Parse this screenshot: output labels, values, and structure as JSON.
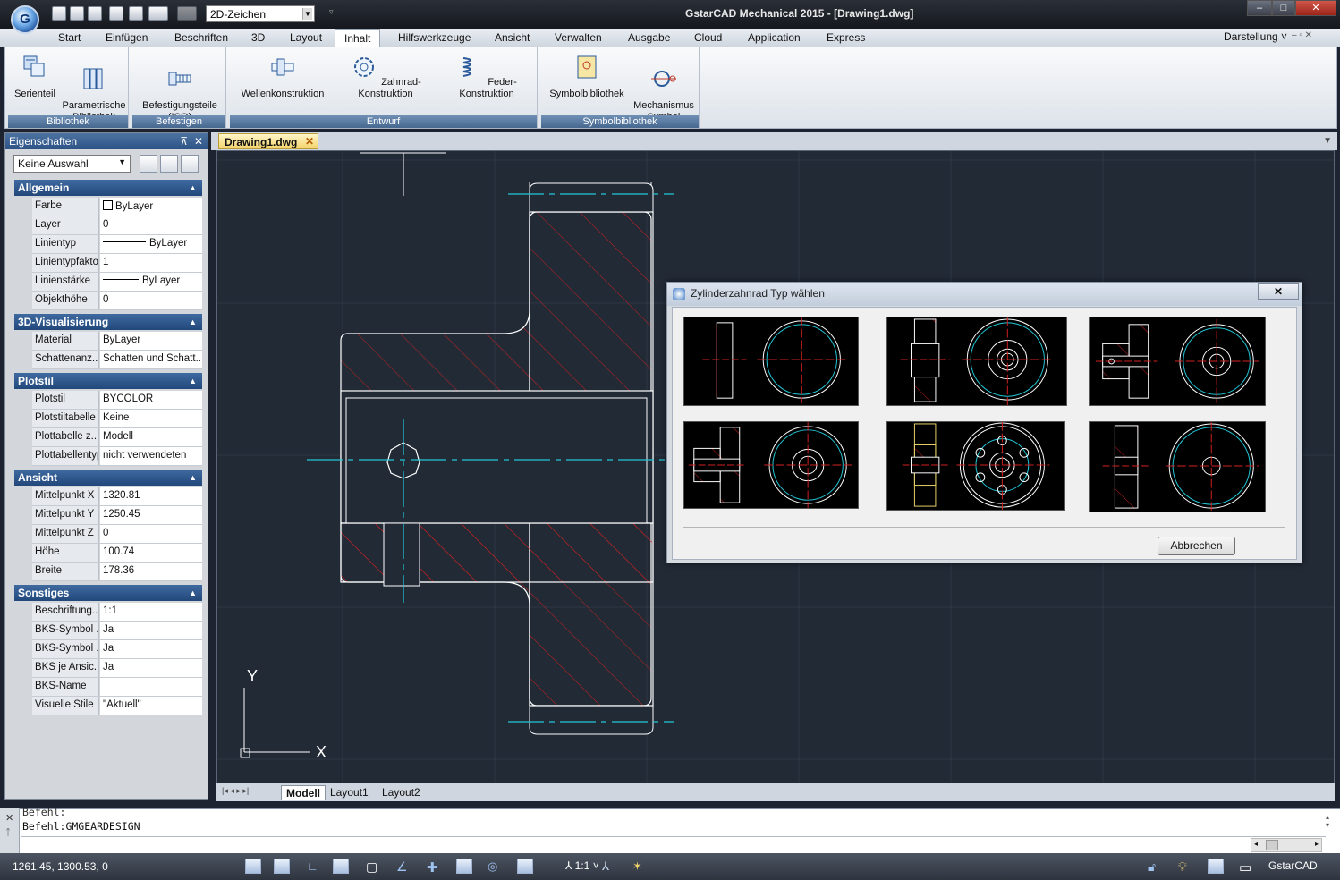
{
  "window": {
    "title": "GstarCAD Mechanical 2015 - [Drawing1.dwg]",
    "workspace": "2D-Zeichen",
    "controls": [
      "‒",
      "□",
      "✕"
    ]
  },
  "menu": {
    "tabs": [
      "Start",
      "Einfügen",
      "Beschriften",
      "3D",
      "Layout",
      "Inhalt",
      "Hilfswerkzeuge",
      "Ansicht",
      "Verwalten",
      "Ausgabe",
      "Cloud",
      "Application",
      "Express"
    ],
    "active": "Inhalt",
    "right": "Darstellung"
  },
  "ribbon": {
    "groups": [
      {
        "label": "Bibliothek",
        "buttons": [
          "Serienteil",
          "Parametrische\nBibliothek"
        ]
      },
      {
        "label": "Befestigen",
        "buttons": [
          "Befestigungsteile\n(ISO)"
        ]
      },
      {
        "label": "Entwurf",
        "buttons": [
          "Wellenkonstruktion",
          "Zahnrad-Konstruktion",
          "Feder-Konstruktion"
        ]
      },
      {
        "label": "Symbolbibliothek",
        "buttons": [
          "Symbolbibliothek",
          "Mechanismus\nSymbol"
        ]
      }
    ]
  },
  "properties": {
    "title": "Eigenschaften",
    "selection": "Keine Auswahl",
    "sections": [
      {
        "title": "Allgemein",
        "rows": [
          [
            "Farbe",
            "ByLayer"
          ],
          [
            "Layer",
            "0"
          ],
          [
            "Linientyp",
            "ByLayer"
          ],
          [
            "Linientypfaktor",
            "1"
          ],
          [
            "Linienstärke",
            "ByLayer"
          ],
          [
            "Objekthöhe",
            "0"
          ]
        ]
      },
      {
        "title": "3D-Visualisierung",
        "rows": [
          [
            "Material",
            "ByLayer"
          ],
          [
            "Schattenanz...",
            "Schatten und Schatt..."
          ]
        ]
      },
      {
        "title": "Plotstil",
        "rows": [
          [
            "Plotstil",
            "BYCOLOR"
          ],
          [
            "Plotstiltabelle",
            "Keine"
          ],
          [
            "Plottabelle z...",
            "Modell"
          ],
          [
            "Plottabellentyp",
            "nicht verwendeten"
          ]
        ]
      },
      {
        "title": "Ansicht",
        "rows": [
          [
            "Mittelpunkt X",
            "1320.81"
          ],
          [
            "Mittelpunkt Y",
            "1250.45"
          ],
          [
            "Mittelpunkt Z",
            "0"
          ],
          [
            "Höhe",
            "100.74"
          ],
          [
            "Breite",
            "178.36"
          ]
        ]
      },
      {
        "title": "Sonstiges",
        "rows": [
          [
            "Beschriftung...",
            "1:1"
          ],
          [
            "BKS-Symbol ...",
            "Ja"
          ],
          [
            "BKS-Symbol ...",
            "Ja"
          ],
          [
            "BKS je Ansic...",
            "Ja"
          ],
          [
            "BKS-Name",
            ""
          ],
          [
            "Visuelle Stile",
            "\"Aktuell\""
          ]
        ]
      }
    ]
  },
  "document": {
    "tab": "Drawing1.dwg",
    "layouts": [
      "Modell",
      "Layout1",
      "Layout2"
    ],
    "active_layout": "Modell",
    "ucs": {
      "y": "Y",
      "x": "X"
    }
  },
  "dialog": {
    "title": "Zylinderzahnrad Typ wählen",
    "close": "✕",
    "cancel": "Abbrechen",
    "options": [
      "gear-type-1",
      "gear-type-2",
      "gear-type-3",
      "gear-type-4",
      "gear-type-5",
      "gear-type-6"
    ]
  },
  "command": {
    "lines": [
      "Befehl:",
      "Befehl:GMGEARDESIGN"
    ]
  },
  "status": {
    "coords": "1261.45, 1300.53, 0",
    "scale": "1:1",
    "app": "GstarCAD"
  },
  "colors": {
    "canvas": "#222a36",
    "outline": "#ffffff",
    "hatch": "#d22020",
    "centerline": "#22c8d8",
    "accent": "#2d5386"
  }
}
